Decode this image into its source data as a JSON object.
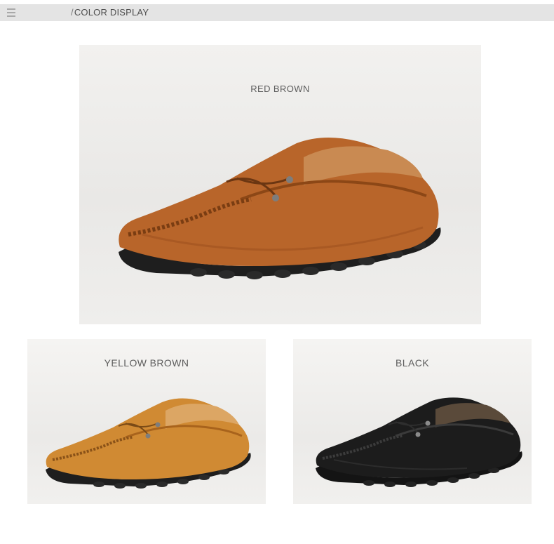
{
  "header": {
    "slash": "/",
    "title": "COLOR DISPLAY"
  },
  "variants": [
    {
      "label": "RED BROWN",
      "upper_color": "#b8652a",
      "upper_shade": "#8c4716",
      "lining_color": "#c98a52"
    },
    {
      "label": "YELLOW BROWN",
      "upper_color": "#d08a33",
      "upper_shade": "#a8631c",
      "lining_color": "#dca664"
    },
    {
      "label": "BLACK",
      "upper_color": "#1c1c1c",
      "upper_shade": "#0a0a0a",
      "lining_color": "#5a4a3a"
    }
  ],
  "icons": {
    "menu": "hamburger-menu-icon"
  }
}
